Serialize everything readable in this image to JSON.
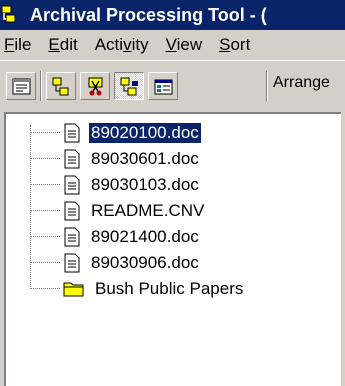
{
  "window": {
    "title": "Archival Processing Tool - ("
  },
  "menu": {
    "items": [
      {
        "pre": "",
        "ul": "F",
        "post": "ile"
      },
      {
        "pre": "",
        "ul": "E",
        "post": "dit"
      },
      {
        "pre": "Acti",
        "ul": "v",
        "post": "ity"
      },
      {
        "pre": "",
        "ul": "V",
        "post": "iew"
      },
      {
        "pre": "",
        "ul": "S",
        "post": "ort"
      }
    ]
  },
  "toolbar": {
    "arrange_label": "Arrange"
  },
  "tree": {
    "items": [
      {
        "label": "89020100.doc",
        "type": "document",
        "selected": true
      },
      {
        "label": "89030601.doc",
        "type": "document"
      },
      {
        "label": "89030103.doc",
        "type": "document"
      },
      {
        "label": "README.CNV",
        "type": "document"
      },
      {
        "label": "89021400.doc",
        "type": "document"
      },
      {
        "label": "89030906.doc",
        "type": "document"
      },
      {
        "label": "Bush Public Papers",
        "type": "folder"
      }
    ]
  },
  "colors": {
    "title_bar": "#0a246a",
    "selection": "#0a246a",
    "chrome": "#d4d0c8",
    "folder": "#ffff00"
  }
}
